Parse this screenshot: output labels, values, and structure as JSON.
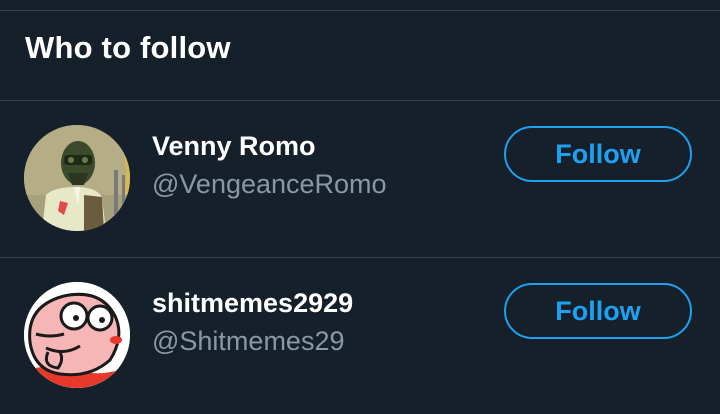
{
  "header": {
    "title": "Who to follow"
  },
  "suggestions": [
    {
      "name": "Venny Romo",
      "handle": "@VengeanceRomo",
      "follow_label": "Follow"
    },
    {
      "name": "shitmemes2929",
      "handle": "@Shitmemes29",
      "follow_label": "Follow"
    }
  ],
  "colors": {
    "background": "#15202b",
    "divider": "#38444d",
    "accent": "#1da1f2",
    "secondary_text": "#8899a6"
  }
}
